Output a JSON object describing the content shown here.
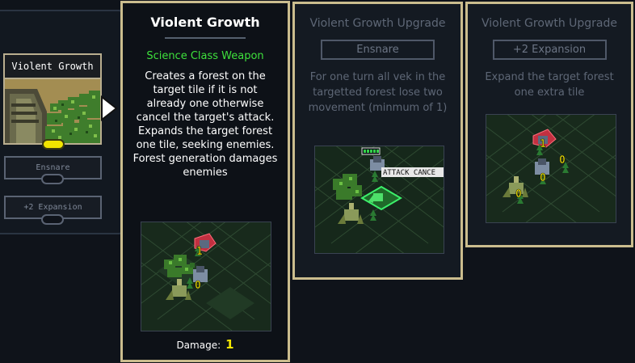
{
  "slot_panel": {
    "weapon_name": "Violent Growth",
    "upgrades": [
      {
        "label": "Ensnare"
      },
      {
        "label": "+2 Expansion"
      }
    ]
  },
  "main_card": {
    "title": "Violent Growth",
    "weapon_class": "Science Class Weapon",
    "description": "Creates a forest on the target tile if it is not already one otherwise cancel the target's attack. Expands the target forest one tile, seeking enemies. Forest generation damages enemies",
    "damage_label": "Damage:",
    "damage_value": "1",
    "preview": {
      "markers": [
        "1",
        "0"
      ]
    }
  },
  "upgrade_cards": [
    {
      "title": "Violent Growth Upgrade",
      "name": "Ensnare",
      "description": "For one turn all vek in the targetted forest lose two movement (minmum of 1)",
      "preview": {
        "overlay_text": "ATTACK CANCE"
      }
    },
    {
      "title": "Violent Growth Upgrade",
      "name": "+2 Expansion",
      "description": "Expand the target forest one extra tile",
      "preview": {
        "markers": [
          "1",
          "0",
          "0",
          "0"
        ]
      }
    }
  ],
  "colors": {
    "card_border": "#cbbd8e",
    "weapon_class": "#3ee13c",
    "damage_value": "#f2e500",
    "dim_text": "#5e6776",
    "power_pill": "#f2e500"
  }
}
